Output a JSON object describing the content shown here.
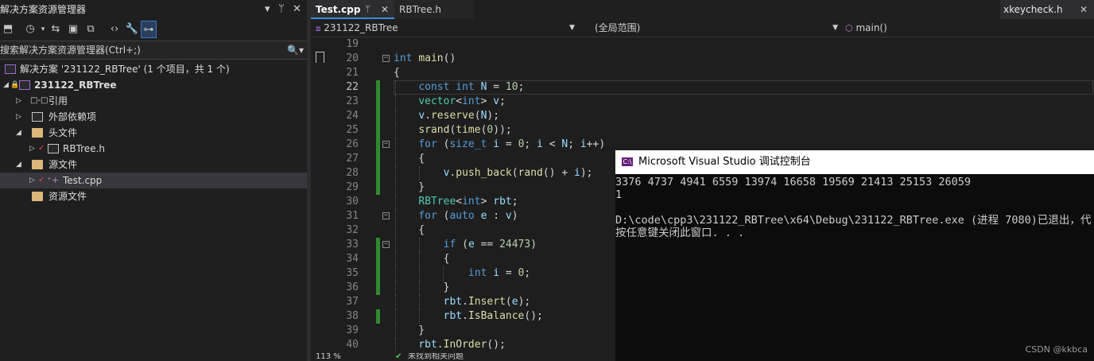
{
  "solution_explorer": {
    "title": "解决方案资源管理器",
    "search_placeholder": "搜索解决方案资源管理器(Ctrl+;)",
    "tree": [
      {
        "label": "解决方案 '231122_RBTree' (1 个项目，共 1 个)"
      },
      {
        "label": "231122_RBTree"
      },
      {
        "label": "引用"
      },
      {
        "label": "外部依赖项"
      },
      {
        "label": "头文件"
      },
      {
        "label": "RBTree.h"
      },
      {
        "label": "源文件"
      },
      {
        "label": "Test.cpp"
      },
      {
        "label": "资源文件"
      }
    ]
  },
  "editor": {
    "tabs": [
      {
        "label": "Test.cpp",
        "active": true
      },
      {
        "label": "RBTree.h",
        "active": false
      },
      {
        "label": "xkeycheck.h",
        "active": false
      }
    ],
    "nav": {
      "project": "231122_RBTree",
      "scope": "(全局范围)",
      "member": "main()"
    },
    "zoom": "113 %",
    "status_text": "未找到相关问题",
    "lines": [
      {
        "n": "19",
        "text": ""
      },
      {
        "n": "20",
        "text": "int main()"
      },
      {
        "n": "21",
        "text": "{"
      },
      {
        "n": "22",
        "text": "    const int N = 10;"
      },
      {
        "n": "23",
        "text": "    vector<int> v;"
      },
      {
        "n": "24",
        "text": "    v.reserve(N);"
      },
      {
        "n": "25",
        "text": "    srand(time(0));"
      },
      {
        "n": "26",
        "text": "    for (size_t i = 0; i < N; i++)"
      },
      {
        "n": "27",
        "text": "    {"
      },
      {
        "n": "28",
        "text": "        v.push_back(rand() + i);"
      },
      {
        "n": "29",
        "text": "    }"
      },
      {
        "n": "30",
        "text": "    RBTree<int> rbt;"
      },
      {
        "n": "31",
        "text": "    for (auto e : v)"
      },
      {
        "n": "32",
        "text": "    {"
      },
      {
        "n": "33",
        "text": "        if (e == 24473)"
      },
      {
        "n": "34",
        "text": "        {"
      },
      {
        "n": "35",
        "text": "            int i = 0;"
      },
      {
        "n": "36",
        "text": "        }"
      },
      {
        "n": "37",
        "text": "        rbt.Insert(e);"
      },
      {
        "n": "38",
        "text": "        rbt.IsBalance();"
      },
      {
        "n": "39",
        "text": "    }"
      },
      {
        "n": "40",
        "text": "    rbt.InOrder();"
      }
    ]
  },
  "console": {
    "title": "Microsoft Visual Studio 调试控制台",
    "output": [
      "3376 4737 4941 6559 13974 16658 19569 21413 25153 26059",
      "1",
      "",
      "D:\\code\\cpp3\\231122_RBTree\\x64\\Debug\\231122_RBTree.exe (进程 7080)已退出，代",
      "按任意键关闭此窗口. . ."
    ]
  },
  "watermark": "CSDN @kkbca"
}
